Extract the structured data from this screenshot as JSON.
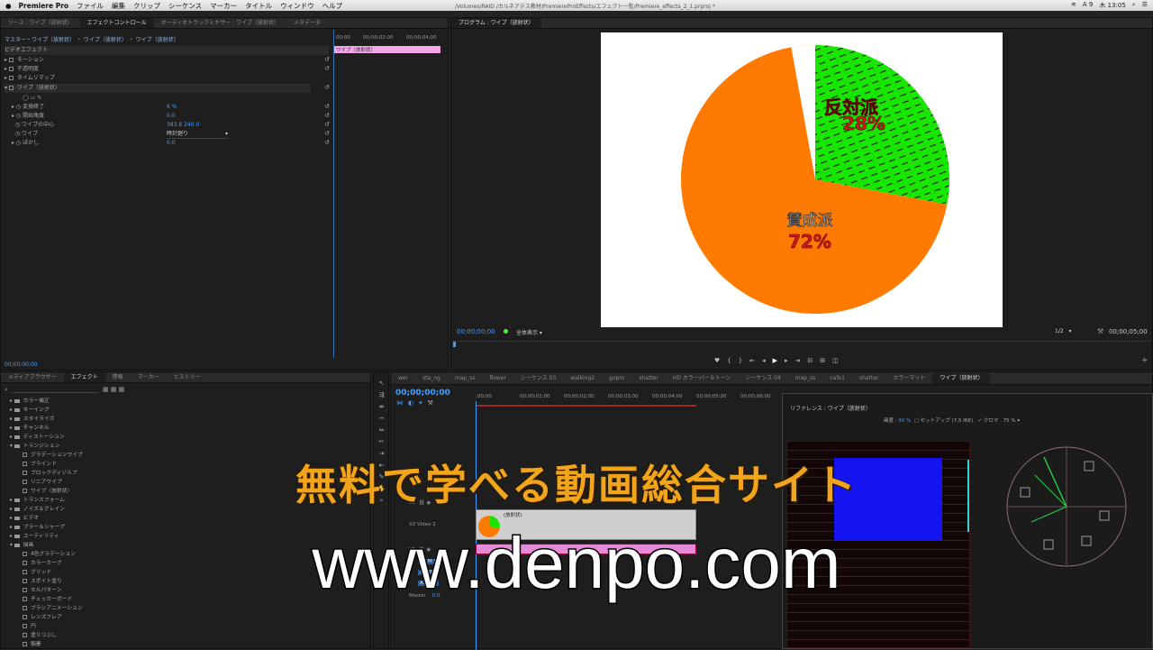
{
  "menubar": {
    "app": "Premiere Pro",
    "items": [
      "ファイル",
      "編集",
      "クリップ",
      "シーケンス",
      "マーカー",
      "タイトル",
      "ウィンドウ",
      "ヘルプ"
    ],
    "path": "/Volumes/RAID /カルネアデス教材/PremiereProEffects/エフェクト一覧/Premiere_effects_2_1.prproj *",
    "tray": [
      "A 9",
      "木 13:05"
    ]
  },
  "left_top": {
    "tabs": [
      "ソース : ワイプ（放射状）",
      "エフェクトコントロール",
      "オーディオトラックミキサー : ワイプ（放射状）",
      "メタデータ"
    ],
    "master": "マスター・ワイプ（放射状） ・ ワイプ（放射状） ・ ワイプ（放射状）",
    "section": "ビデオエフェクト",
    "effects": [
      "モーション",
      "不透明度",
      "タイムリマップ",
      "ワイプ（放射状）"
    ],
    "params": [
      {
        "name": "変換終了",
        "value": "6 %"
      },
      {
        "name": "開始角度",
        "value": "0.0"
      },
      {
        "name": "ワイプの中心",
        "value": "383.8    240.0"
      },
      {
        "name": "ワイプ",
        "value": "時計廻り"
      },
      {
        "name": "ぼかし",
        "value": "0.0"
      }
    ],
    "ruler": [
      "00;00",
      "00;00;02;00",
      "00;00;04;00"
    ],
    "clip": "ワイプ（放射状）",
    "timecode": "00;00;00;00"
  },
  "program": {
    "title": "プログラム : ワイプ（放射状）",
    "timecode_left": "00;00;00;00",
    "fit": "全体表示",
    "scale": "1/2",
    "timecode_right": "00;00;05;00"
  },
  "chart_data": {
    "type": "pie",
    "values": [
      72,
      28
    ],
    "labels": [
      "賛成派",
      "反対派"
    ],
    "value_labels": [
      "72%",
      "28%"
    ],
    "colors": [
      "#ff7a00",
      "#19e600"
    ]
  },
  "effects_panel": {
    "tabs": [
      "メディアブラウザー",
      "エフェクト",
      "情報",
      "マーカー",
      "ヒストリー"
    ],
    "items": [
      {
        "t": "f",
        "l": "カラー補正"
      },
      {
        "t": "f",
        "l": "キーイング"
      },
      {
        "t": "f",
        "l": "スタイライズ"
      },
      {
        "t": "f",
        "l": "チャンネル"
      },
      {
        "t": "f",
        "l": "ディストーション"
      },
      {
        "t": "fo",
        "l": "トランジション"
      },
      {
        "t": "e",
        "l": "グラデーションワイプ"
      },
      {
        "t": "e",
        "l": "ブラインド"
      },
      {
        "t": "e",
        "l": "ブロックディゾルブ"
      },
      {
        "t": "e",
        "l": "リニアワイプ"
      },
      {
        "t": "e",
        "l": "ワイプ（放射状）"
      },
      {
        "t": "f",
        "l": "トランスフォーム"
      },
      {
        "t": "f",
        "l": "ノイズ＆グレイン"
      },
      {
        "t": "f",
        "l": "ビデオ"
      },
      {
        "t": "f",
        "l": "ブラー＆シャープ"
      },
      {
        "t": "f",
        "l": "ユーティリティ"
      },
      {
        "t": "fo",
        "l": "描画"
      },
      {
        "t": "e",
        "l": "4色グラデーション"
      },
      {
        "t": "e",
        "l": "カラーカーブ"
      },
      {
        "t": "e",
        "l": "グリッド"
      },
      {
        "t": "e",
        "l": "スポイト塗り"
      },
      {
        "t": "e",
        "l": "セルパターン"
      },
      {
        "t": "e",
        "l": "チェッカーボード"
      },
      {
        "t": "e",
        "l": "ブラシアニメーション"
      },
      {
        "t": "e",
        "l": "レンズフレア"
      },
      {
        "t": "e",
        "l": "円"
      },
      {
        "t": "e",
        "l": "塗りつぶし"
      },
      {
        "t": "e",
        "l": "稲妻"
      }
    ]
  },
  "timeline": {
    "tabs": [
      "wer",
      "sta_ng",
      "map_ss",
      "flower",
      "シーケンス 03",
      "walking2",
      "gopro",
      "shatter",
      "HD カラーバー＆トーン",
      "シーケンス 04",
      "map_ss",
      "cafe1",
      "shatter",
      "カラーマット",
      "ワイプ（放射状）"
    ],
    "timecode": "00;00;00;00",
    "ruler": [
      ";00;00",
      "00;00;01;00",
      "00;00;02;00",
      "00;00;03;00",
      "00;00;04;00",
      "00;00;05;00",
      "00;00;06;00",
      "00;00"
    ],
    "tracks": [
      "V3",
      "V2  Video 2",
      "V1",
      "A1",
      "A2",
      "A3",
      "Master"
    ],
    "master_val": "0.0",
    "clip_label": "(放射状)"
  },
  "reference": {
    "title": "リファレンス : ワイプ（放射状）",
    "zoom_label": "画度 :",
    "zoom": "50 %",
    "setup": "セットアップ (7.5 IRE)",
    "chroma": "✓ クロマ",
    "level": "75 %"
  },
  "overlay": {
    "line1": "無料で学べる動画総合サイト",
    "line2": "www.denpo.com"
  }
}
